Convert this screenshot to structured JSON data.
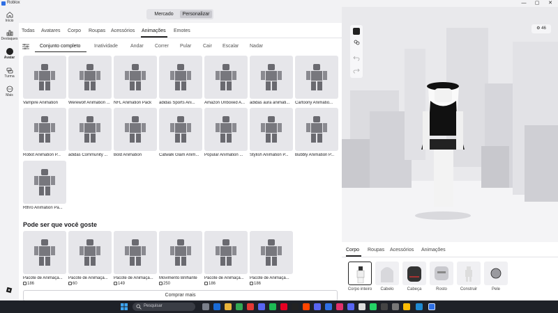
{
  "window": {
    "title": "Roblox",
    "controls": [
      "—",
      "▢",
      "✕"
    ]
  },
  "rail": [
    {
      "label": "Início",
      "icon": "home-icon"
    },
    {
      "label": "Destaques",
      "icon": "charts-icon"
    },
    {
      "label": "Avatar",
      "icon": "avatar-icon"
    },
    {
      "label": "Turma",
      "icon": "party-icon"
    },
    {
      "label": "Mais",
      "icon": "more-icon"
    }
  ],
  "segments": {
    "market": "Mercado",
    "customize": "Personalizar",
    "active": "Personalizar"
  },
  "category_tabs": [
    "Todas",
    "Avatares",
    "Corpo",
    "Roupas",
    "Acessórios",
    "Animações",
    "Emotes"
  ],
  "active_category": "Animações",
  "filter_chips": [
    "Conjunto completo",
    "Inatividade",
    "Andar",
    "Correr",
    "Pular",
    "Cair",
    "Escalar",
    "Nadar"
  ],
  "active_chip": "Conjunto completo",
  "items": [
    "Vampire Animation",
    "Werewolf Animation ...",
    "NFL Animation Pack",
    "adidas Sports Ani...",
    "Amazon Unboxed A...",
    "adidas aura animati...",
    "Cartoony Animatio...",
    "Robot Animation P...",
    "adidas Community ...",
    "Bold Animation",
    "Catwalk Glam Anim...",
    "Popular Animation ...",
    "Stylish Animation P...",
    "Bubbly Animation P...",
    "Rthro Animation Pa..."
  ],
  "recommendations_heading": "Pode ser que você goste",
  "recommendations": [
    {
      "name": "Pacote de Animaçã...",
      "price": "186"
    },
    {
      "name": "Pacote de Animaçã...",
      "price": "60"
    },
    {
      "name": "Pacote de Animaçã...",
      "price": "149"
    },
    {
      "name": "Movimento Brilhante",
      "price": "250"
    },
    {
      "name": "Pacote de Animaçã...",
      "price": "186"
    },
    {
      "name": "Pacote de Animaçã...",
      "price": "186"
    }
  ],
  "more_button": "Comprar mais",
  "preview": {
    "count": "46"
  },
  "wardrobe_tabs": [
    "Corpo",
    "Roupas",
    "Acessórios",
    "Animações"
  ],
  "active_wardrobe_tab": "Corpo",
  "wardrobe_items": [
    "Corpo inteiro",
    "Cabelo",
    "Cabeça",
    "Rosto",
    "Construir",
    "Pele"
  ],
  "taskbar": {
    "search_placeholder": "Pesquisar"
  },
  "colors": {
    "accent": "#2f6fe4",
    "panel": "#ffffff",
    "thumb": "#e6e6ea",
    "taskbar": "#1e2128"
  }
}
